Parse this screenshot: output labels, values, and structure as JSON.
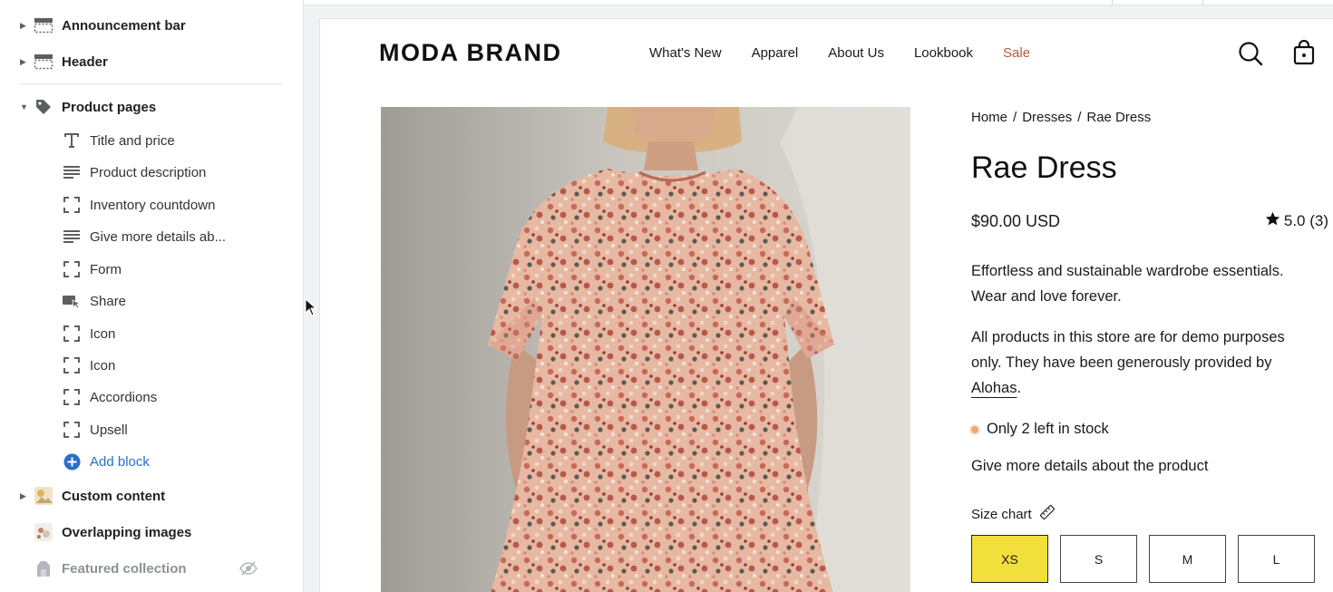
{
  "sidebar": {
    "sections": [
      {
        "label": "Announcement bar",
        "icon": "section-layout-icon"
      },
      {
        "label": "Header",
        "icon": "header-layout-icon"
      },
      {
        "label": "Product pages",
        "icon": "tag-icon"
      }
    ],
    "blocks": [
      {
        "label": "Title and price",
        "icon": "text-t-icon"
      },
      {
        "label": "Product description",
        "icon": "text-lines-icon"
      },
      {
        "label": "Inventory countdown",
        "icon": "block-frame-icon"
      },
      {
        "label": "Give more details ab...",
        "icon": "text-lines-icon"
      },
      {
        "label": "Form",
        "icon": "block-frame-icon"
      },
      {
        "label": "Share",
        "icon": "share-icon"
      },
      {
        "label": "Icon",
        "icon": "block-frame-icon"
      },
      {
        "label": "Icon",
        "icon": "block-frame-icon"
      },
      {
        "label": "Accordions",
        "icon": "block-frame-icon"
      },
      {
        "label": "Upsell",
        "icon": "block-frame-icon"
      }
    ],
    "add_block_label": "Add block",
    "more_sections": [
      {
        "label": "Custom content",
        "icon": "image-thumb-icon"
      },
      {
        "label": "Overlapping images",
        "icon": "image-thumb-icon"
      },
      {
        "label": "Featured collection",
        "icon": "collection-icon",
        "hidden": true
      }
    ]
  },
  "store": {
    "brand": "MODA BRAND",
    "nav": [
      "What's New",
      "Apparel",
      "About Us",
      "Lookbook",
      "Sale"
    ],
    "sale_color": "#b45a3c"
  },
  "product": {
    "breadcrumb": [
      "Home",
      "Dresses",
      "Rae Dress"
    ],
    "breadcrumb_sep": "/",
    "title": "Rae Dress",
    "price": "$90.00 USD",
    "rating": "5.0 (3)",
    "description": "Effortless and sustainable wardrobe essentials. Wear and love forever.",
    "demo_note_prefix": "All products in this store are for demo purposes only. They have been generously provided by ",
    "demo_note_link": "Alohas",
    "demo_note_suffix": ".",
    "stock": "Only 2 left in stock",
    "details": "Give more details about the product",
    "size_chart_label": "Size chart",
    "sizes": [
      "XS",
      "S",
      "M",
      "L"
    ],
    "selected_size": "XS",
    "selected_color": "#f1df3c"
  }
}
